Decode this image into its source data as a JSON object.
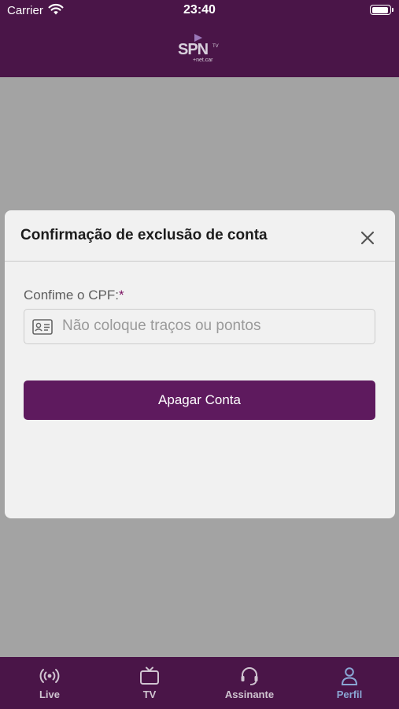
{
  "status_bar": {
    "carrier": "Carrier",
    "time": "23:40"
  },
  "header": {
    "logo_text": "SPN",
    "logo_badge": "TV",
    "logo_sub": "+net.car"
  },
  "modal": {
    "title": "Confirmação de exclusão de conta",
    "field_label": "Confime o CPF:",
    "required_mark": "*",
    "input_placeholder": "Não coloque traços ou pontos",
    "input_value": "",
    "submit_label": "Apagar Conta"
  },
  "tabs": [
    {
      "label": "Live",
      "icon": "live-broadcast-icon"
    },
    {
      "label": "TV",
      "icon": "tv-icon"
    },
    {
      "label": "Assinante",
      "icon": "headset-icon"
    },
    {
      "label": "Perfil",
      "icon": "person-icon",
      "active": true
    }
  ],
  "colors": {
    "header": "#4a1548",
    "overlay": "#a3a3a3",
    "button": "#5e1a5e",
    "active_tab": "#8aa7d4"
  }
}
